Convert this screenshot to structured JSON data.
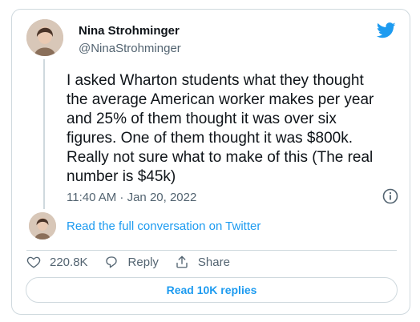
{
  "tweet": {
    "author_name": "Nina Strohminger",
    "author_handle": "@NinaStrohminger",
    "text": "I asked Wharton students what they thought\nthe average American worker makes per year\nand 25% of them thought it was over six\nfigures. One of them thought it was $800k.\nReally not sure what to make of this (The real\nnumber is $45k)",
    "timestamp": "11:40 AM · Jan 20, 2022"
  },
  "conversation_link": "Read the full conversation on Twitter",
  "actions": {
    "like_count": "220.8K",
    "reply_label": "Reply",
    "share_label": "Share"
  },
  "replies_button": "Read 10K replies",
  "colors": {
    "accent": "#1d9bf0",
    "muted_text": "#536471",
    "border": "#cfd9de"
  },
  "icons": [
    "twitter-bird-icon",
    "info-icon",
    "heart-icon",
    "reply-icon",
    "share-icon"
  ]
}
